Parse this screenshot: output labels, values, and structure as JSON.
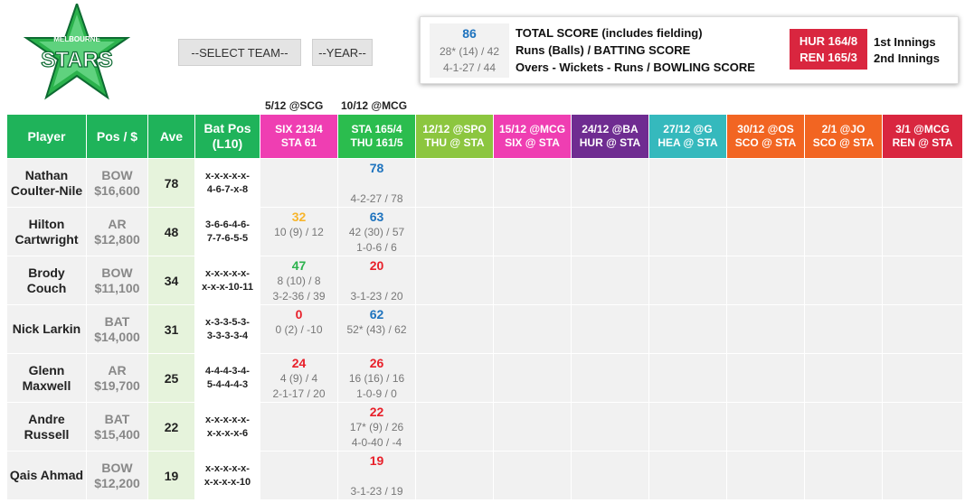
{
  "controls": {
    "team_label": "--SELECT TEAM--",
    "year_label": "--YEAR--"
  },
  "logo": {
    "text_top": "MELBOURNE",
    "text_main": "STARS"
  },
  "legend": {
    "sample_total": "86",
    "sample_batting": "28* (14) / 42",
    "sample_bowling": "4-1-27 / 44",
    "label_total": "TOTAL SCORE (includes fielding)",
    "label_batting": "Runs (Balls) / BATTING SCORE",
    "label_bowling": "Overs - Wickets - Runs / BOWLING SCORE",
    "inn1_score": "HUR 164/8",
    "inn2_score": "REN 165/3",
    "inn1_label": "1st Innings",
    "inn2_label": "2nd Innings"
  },
  "previous_games": [
    "5/12 @SCG",
    "10/12 @MCG"
  ],
  "headers": {
    "player": "Player",
    "pos": "Pos / $",
    "ave": "Ave",
    "batpos_1": "Bat Pos",
    "batpos_2": "(L10)"
  },
  "games": [
    {
      "line1": "SIX 213/4",
      "line2": "STA 61",
      "color": "#ef3eb2"
    },
    {
      "line1": "STA 165/4",
      "line2": "THU 161/5",
      "color": "#2bbd4e"
    },
    {
      "line1": "12/12 @SPO",
      "line2": "THU @ STA",
      "color": "#8cc63f"
    },
    {
      "line1": "15/12 @MCG",
      "line2": "SIX @ STA",
      "color": "#ef3eb2"
    },
    {
      "line1": "24/12 @BA",
      "line2": "HUR @ STA",
      "color": "#6f2c91"
    },
    {
      "line1": "27/12 @G",
      "line2": "HEA @ STA",
      "color": "#35b9bd"
    },
    {
      "line1": "30/12 @OS",
      "line2": "SCO @ STA",
      "color": "#f26522"
    },
    {
      "line1": "2/1 @JO",
      "line2": "SCO @ STA",
      "color": "#f26522"
    },
    {
      "line1": "3/1 @MCG",
      "line2": "REN @ STA",
      "color": "#d9263f"
    }
  ],
  "players": [
    {
      "name": "Nathan Coulter-Nile",
      "role": "BOW",
      "price": "$16,600",
      "ave": "78",
      "batpos_1": "x-x-x-x-x-",
      "batpos_2": "4-6-7-x-8",
      "games": [
        null,
        {
          "total": "78",
          "total_color": "#1e73be",
          "bat": "",
          "bowl": "4-2-27 / 78"
        }
      ]
    },
    {
      "name": "Hilton Cartwright",
      "role": "AR",
      "price": "$12,800",
      "ave": "48",
      "batpos_1": "3-6-6-4-6-",
      "batpos_2": "7-7-6-5-5",
      "games": [
        {
          "total": "32",
          "total_color": "#f7b52c",
          "bat": "10 (9) / 12",
          "bowl": ""
        },
        {
          "total": "63",
          "total_color": "#1e73be",
          "bat": "42 (30) / 57",
          "bowl": "1-0-6 / 6"
        }
      ]
    },
    {
      "name": "Brody Couch",
      "role": "BOW",
      "price": "$11,100",
      "ave": "34",
      "batpos_1": "x-x-x-x-x-",
      "batpos_2": "x-x-x-10-11",
      "games": [
        {
          "total": "47",
          "total_color": "#2bb24c",
          "bat": "8 (10) / 8",
          "bowl": "3-2-36 / 39"
        },
        {
          "total": "20",
          "total_color": "#e8202a",
          "bat": "",
          "bowl": "3-1-23 / 20"
        }
      ]
    },
    {
      "name": "Nick Larkin",
      "role": "BAT",
      "price": "$14,000",
      "ave": "31",
      "batpos_1": "x-3-3-5-3-",
      "batpos_2": "3-3-3-3-4",
      "games": [
        {
          "total": "0",
          "total_color": "#e8202a",
          "bat": "0 (2) / -10",
          "bowl": ""
        },
        {
          "total": "62",
          "total_color": "#1e73be",
          "bat": "52* (43) / 62",
          "bowl": ""
        }
      ]
    },
    {
      "name": "Glenn Maxwell",
      "role": "AR",
      "price": "$19,700",
      "ave": "25",
      "batpos_1": "4-4-4-3-4-",
      "batpos_2": "5-4-4-4-3",
      "games": [
        {
          "total": "24",
          "total_color": "#e8202a",
          "bat": "4 (9) / 4",
          "bowl": "2-1-17 / 20"
        },
        {
          "total": "26",
          "total_color": "#e8202a",
          "bat": "16 (16) / 16",
          "bowl": "1-0-9 / 0"
        }
      ]
    },
    {
      "name": "Andre Russell",
      "role": "BAT",
      "price": "$15,400",
      "ave": "22",
      "batpos_1": "x-x-x-x-x-",
      "batpos_2": "x-x-x-x-6",
      "games": [
        null,
        {
          "total": "22",
          "total_color": "#e8202a",
          "bat": "17* (9) / 26",
          "bowl": "4-0-40 / -4"
        }
      ]
    },
    {
      "name": "Qais Ahmad",
      "role": "BOW",
      "price": "$12,200",
      "ave": "19",
      "batpos_1": "x-x-x-x-x-",
      "batpos_2": "x-x-x-x-10",
      "games": [
        null,
        {
          "total": "19",
          "total_color": "#e8202a",
          "bat": "",
          "bowl": "3-1-23 / 19"
        }
      ]
    }
  ]
}
